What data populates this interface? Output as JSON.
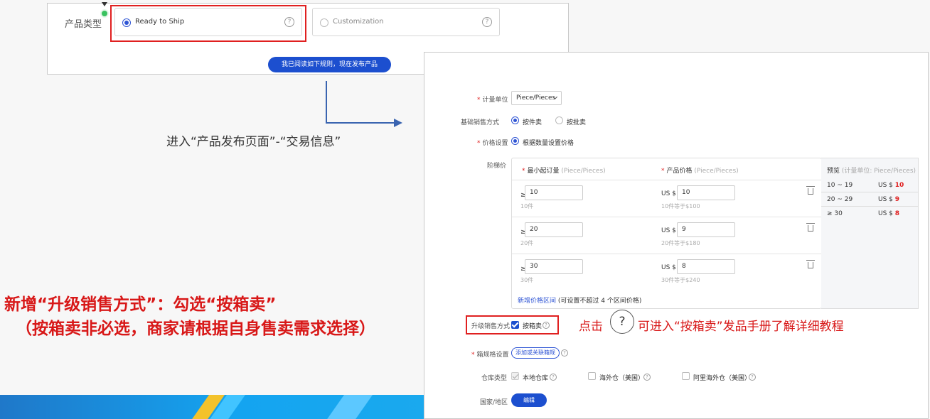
{
  "top": {
    "product_type_label": "产品类型",
    "option_ready": "Ready to Ship",
    "option_custom": "Customization",
    "help_glyph": "?",
    "publish_button": "我已阅读如下规则，现在发布产品"
  },
  "step_text": "进入“产品发布页面”-“交易信息”",
  "annotation": {
    "line1": "新增“升级销售方式”：勾选“按箱卖”",
    "line2": "（按箱卖非必选，商家请根据自身售卖需求选择）",
    "click_prefix": "点击",
    "question_glyph": "?",
    "click_suffix": "可进入“按箱卖”发品手册了解详细教程"
  },
  "form": {
    "unit_label": "计量单位",
    "unit_value": "Piece/Pieces",
    "sales_method_label": "基础销售方式",
    "sales_by_piece": "按件卖",
    "sales_by_batch": "按批卖",
    "price_setting_label": "价格设置",
    "price_by_quantity": "根据数量设置价格",
    "tier_price_label": "阶梯价",
    "col_min_order": "最小起订量",
    "col_min_order_unit": "(Piece/Pieces)",
    "col_price": "产品价格",
    "col_price_unit": "(Piece/Pieces)",
    "ge": "≥",
    "currency": "US $",
    "tiers": [
      {
        "qty": "10",
        "qty_hint": "10件",
        "price": "10",
        "price_hint": "10件等于$100"
      },
      {
        "qty": "20",
        "qty_hint": "20件",
        "price": "9",
        "price_hint": "20件等于$180"
      },
      {
        "qty": "30",
        "qty_hint": "30件",
        "price": "8",
        "price_hint": "30件等于$240"
      }
    ],
    "add_tier_link": "新增价格区间",
    "add_tier_note": "(可设置不超过 4 个区间价格)",
    "preview_title": "预览",
    "preview_unit": "(计量单位: Piece/Pieces)",
    "preview_rows": [
      {
        "range": "10 ~ 19",
        "prefix": "US $",
        "price": "10"
      },
      {
        "range": "20 ~ 29",
        "prefix": "US $",
        "price": "9"
      },
      {
        "range": "≥ 30",
        "prefix": "US $",
        "price": "8"
      }
    ],
    "upgrade_label": "升级销售方式",
    "upgrade_option": "按箱卖",
    "box_spec_label": "箱规格设置",
    "box_spec_button": "添加或关联箱规",
    "warehouse_label": "仓库类型",
    "warehouse_local": "本地仓库",
    "warehouse_overseas": "海外仓（美国）",
    "warehouse_ali_overseas": "阿里海外仓（美国）",
    "region_label": "国家/地区",
    "edit_button": "编辑",
    "help_glyph": "?"
  }
}
